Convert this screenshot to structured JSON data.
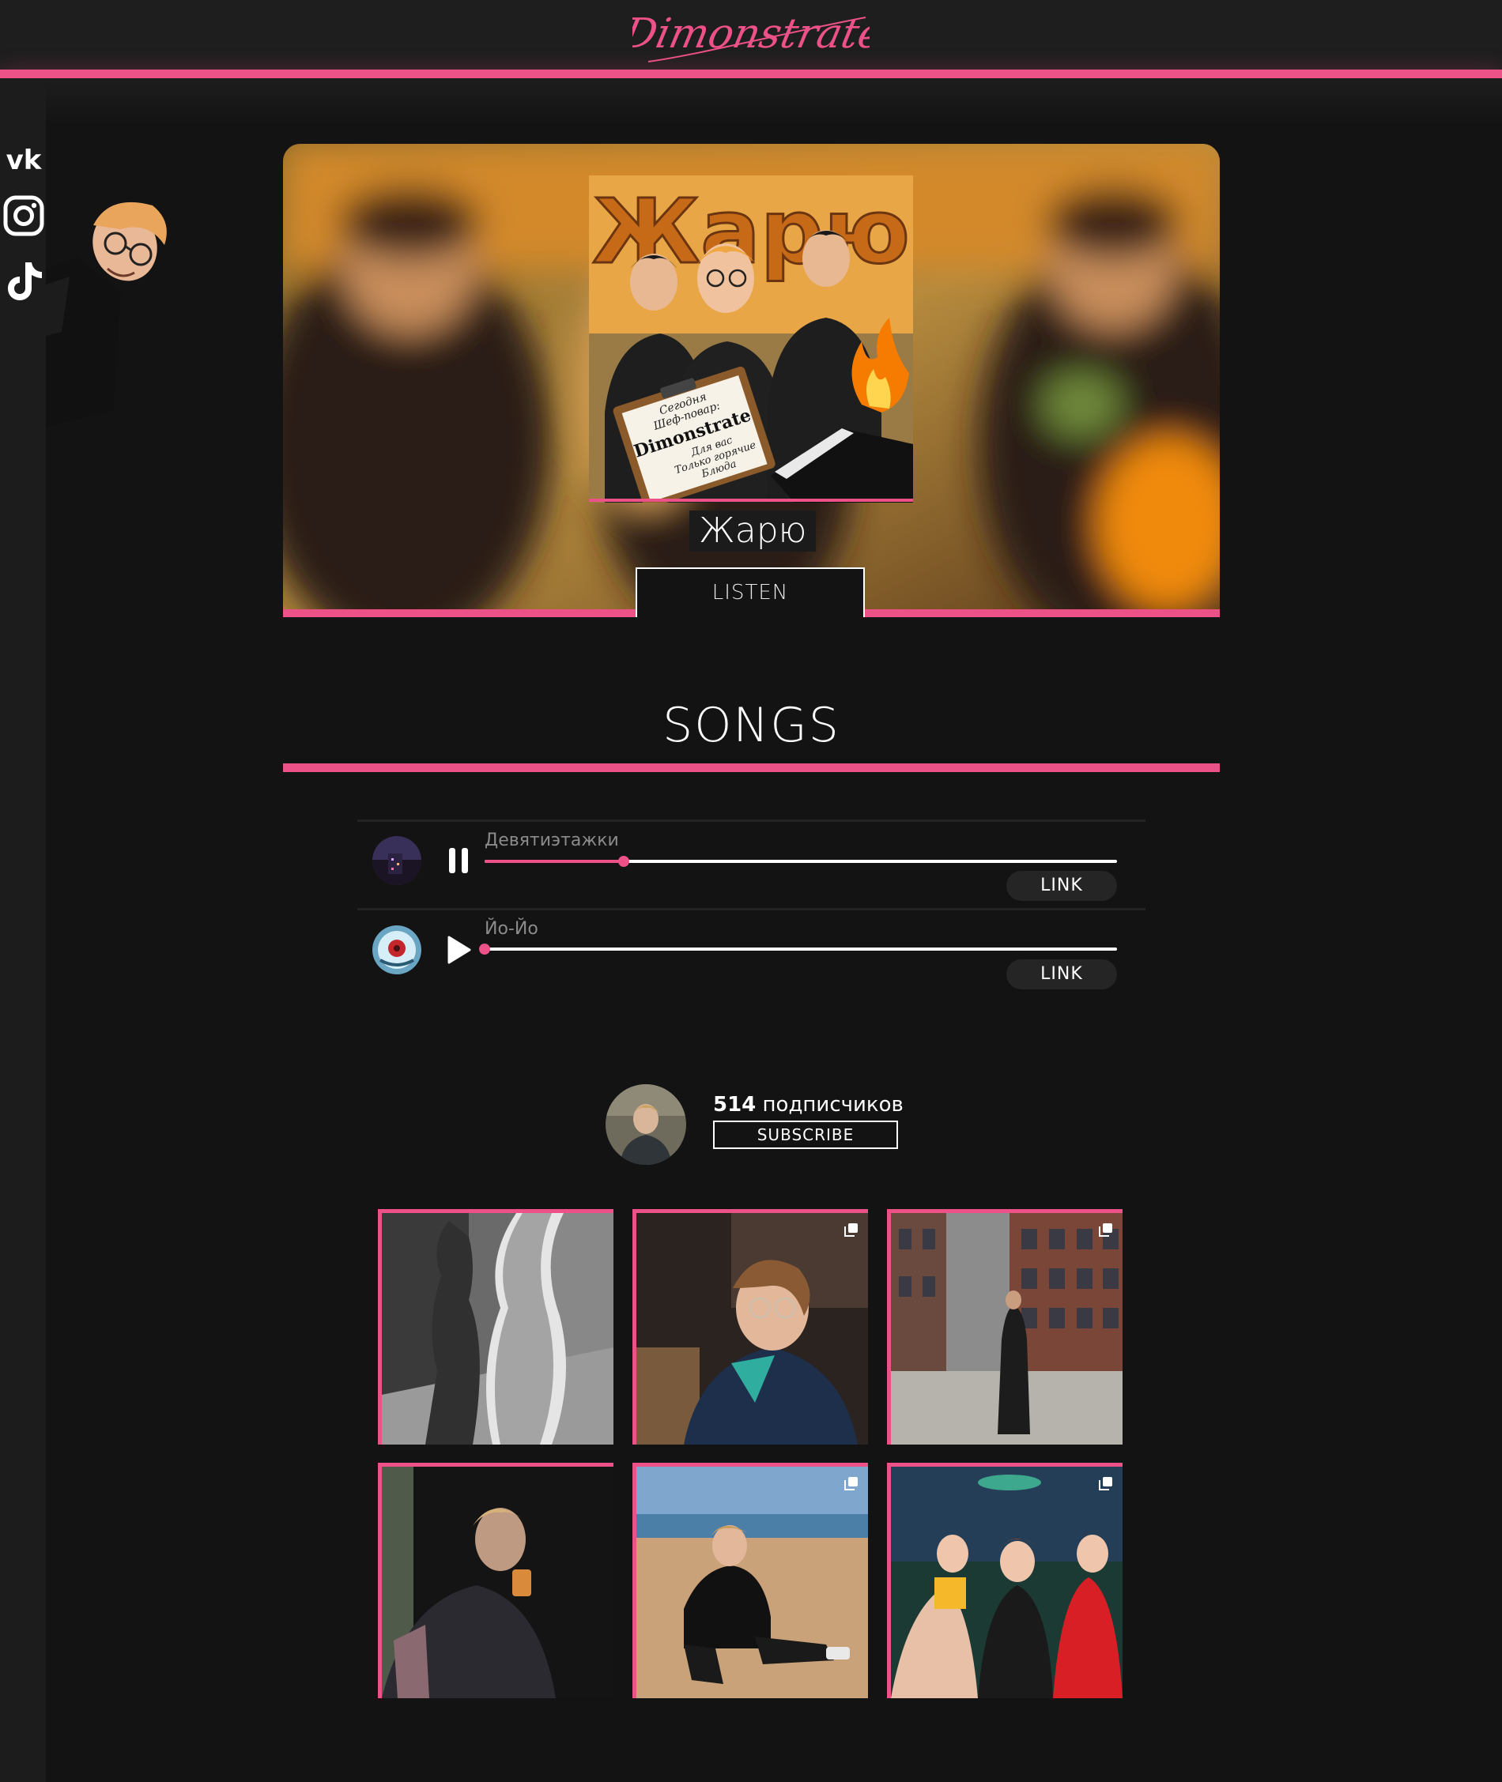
{
  "header": {
    "logo_text": "Dimonstrate",
    "accent_color": "#ec5187"
  },
  "social": [
    {
      "name": "vk",
      "icon": "vk-icon"
    },
    {
      "name": "instagram",
      "icon": "instagram-icon"
    },
    {
      "name": "tiktok",
      "icon": "tiktok-icon"
    }
  ],
  "hero": {
    "cover_heading": "Жарю",
    "cover_note_lines": [
      "Сегодня",
      "Шеф-повар:",
      "Dimonstrate",
      "Для вас",
      "Только горячие",
      "Блюда"
    ],
    "album_title": "Жарю",
    "listen_label": "LISTEN"
  },
  "songs": {
    "title": "SONGS",
    "items": [
      {
        "name": "Девятиэтажки",
        "state": "playing",
        "control_icon": "pause-icon",
        "progress": 0.22,
        "link_label": "LINK"
      },
      {
        "name": "Йо-Йо",
        "state": "paused",
        "control_icon": "play-icon",
        "progress": 0.0,
        "link_label": "LINK"
      }
    ]
  },
  "instagram": {
    "followers_count": "514",
    "followers_label": " подписчиков",
    "subscribe_label": "SUBSCRIBE",
    "posts": [
      {
        "id": 1,
        "multi": false
      },
      {
        "id": 2,
        "multi": true
      },
      {
        "id": 3,
        "multi": true
      },
      {
        "id": 4,
        "multi": false
      },
      {
        "id": 5,
        "multi": true
      },
      {
        "id": 6,
        "multi": true
      }
    ]
  }
}
